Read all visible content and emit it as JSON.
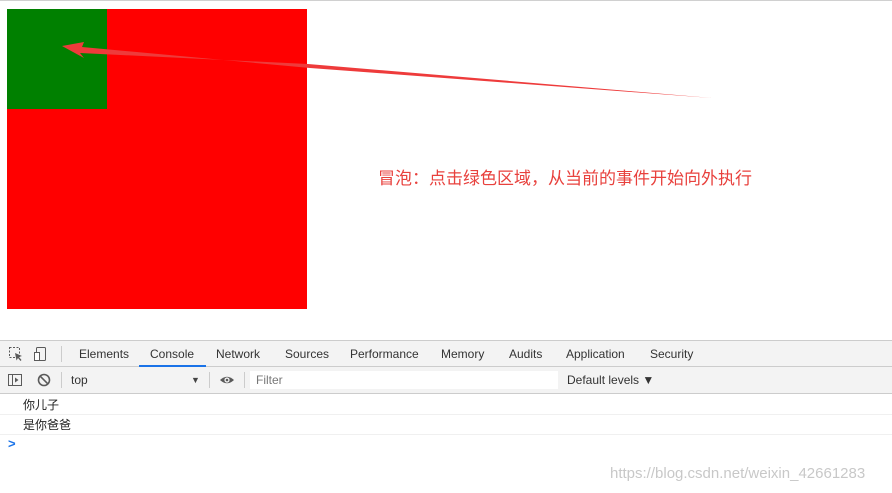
{
  "colors": {
    "outer_box": "#ff0000",
    "inner_box": "#008000",
    "annotation": "#e8413d",
    "arrow": "#ee3b3b",
    "tab_active_underline": "#1a73e8"
  },
  "annotation": {
    "text": "冒泡：点击绿色区域，从当前的事件开始向外执行"
  },
  "devtools": {
    "toolbar_icons": [
      "inspect-element-icon",
      "device-toolbar-icon"
    ],
    "tabs": [
      "Elements",
      "Console",
      "Network",
      "Sources",
      "Performance",
      "Memory",
      "Audits",
      "Application",
      "Security"
    ],
    "active_tab": "Console"
  },
  "console_toolbar": {
    "sidebar_icon": "show-sidebar-icon",
    "clear_icon": "clear-console-icon",
    "context": "top",
    "eye_icon": "live-expression-eye-icon",
    "filter_placeholder": "Filter",
    "levels": "Default levels ▼"
  },
  "console": {
    "lines": [
      "你儿子",
      "是你爸爸"
    ],
    "prompt": ">"
  },
  "watermark": "https://blog.csdn.net/weixin_42661283"
}
